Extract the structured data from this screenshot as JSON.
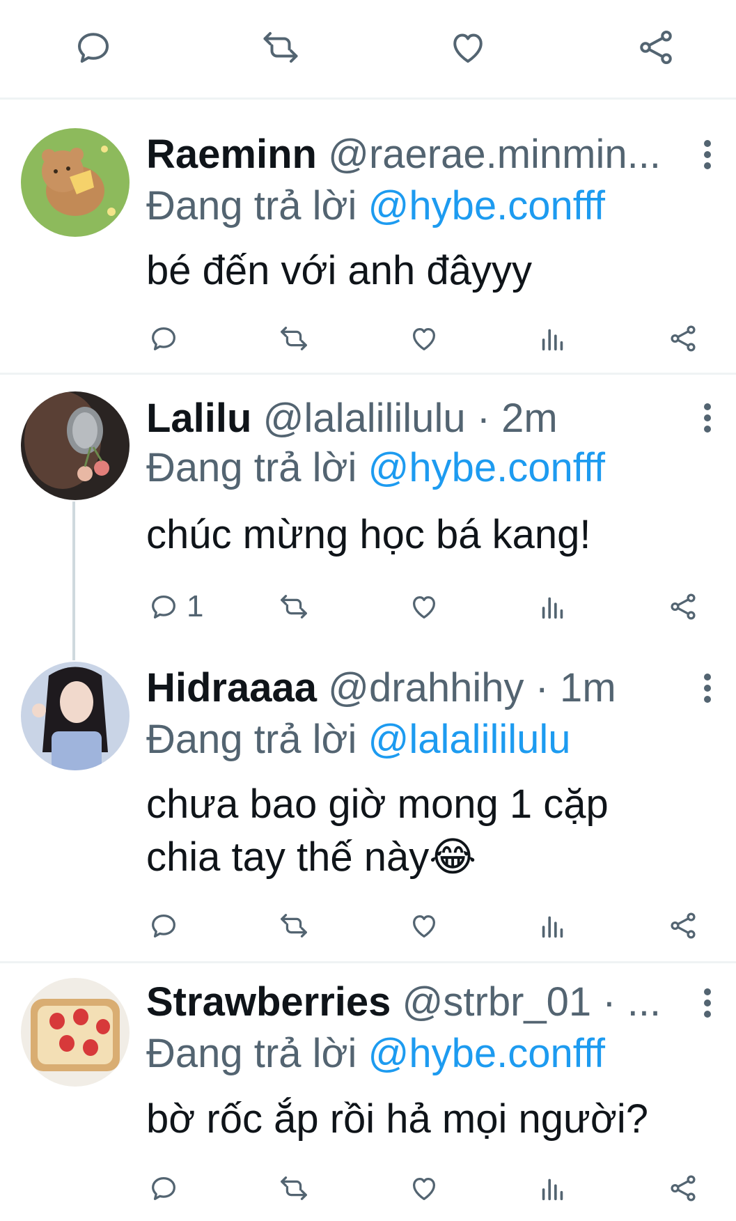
{
  "top_actions": {
    "icons": [
      "reply-icon",
      "retweet-icon",
      "like-icon",
      "share-icon"
    ]
  },
  "tweets": [
    {
      "name": "Raeminn",
      "handle": "@raerae.minmin...",
      "reply_prefix": "Đang trả lời",
      "reply_to": "@hybe.confff",
      "text_lines": [
        "bé đến với anh đâyyy"
      ],
      "reply_count": ""
    },
    {
      "name": "Lalilu",
      "handle": "@lalalililulu · 2m",
      "reply_prefix": "Đang trả lời",
      "reply_to": "@hybe.confff",
      "text_lines": [
        "chúc mừng học bá kang!"
      ],
      "reply_count": "1"
    },
    {
      "name": "Hidraaaa",
      "handle": "@drahhihy · 1m",
      "reply_prefix": "Đang trả lời",
      "reply_to": "@lalalililulu",
      "text_lines": [
        "chưa bao giờ mong 1 cặp",
        "chia tay thế này"
      ],
      "emoji": "😂",
      "reply_count": ""
    },
    {
      "name": "Strawberries",
      "handle": "@strbr_01 · ...",
      "reply_prefix": "Đang trả lời",
      "reply_to": "@hybe.confff",
      "text_lines": [
        "bờ rốc ắp rồi hả mọi người?"
      ],
      "reply_count": ""
    }
  ],
  "colors": {
    "accent": "#1d9bf0",
    "secondary_text": "#536471",
    "primary_text": "#0f1419",
    "divider": "#eff3f4"
  }
}
